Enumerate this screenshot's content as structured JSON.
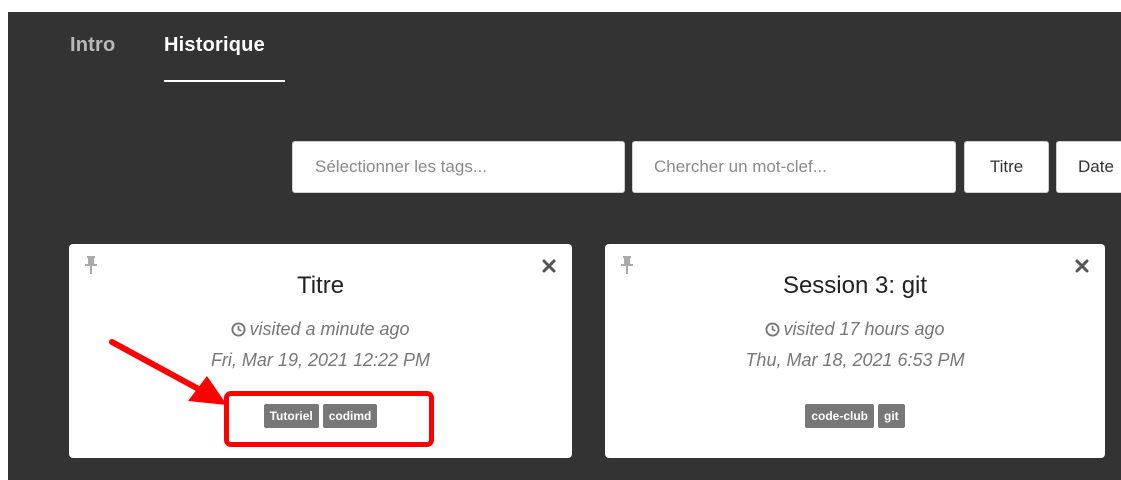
{
  "tabs": {
    "intro_label": "Intro",
    "historique_label": "Historique"
  },
  "toolbar": {
    "tags_placeholder": "Sélectionner les tags...",
    "search_placeholder": "Chercher un mot-clef...",
    "sort_title_label": "Titre",
    "sort_date_label": "Date"
  },
  "cards": [
    {
      "title": "Titre",
      "visited": "visited a minute ago",
      "date": "Fri, Mar 19, 2021 12:22 PM",
      "tags": [
        "Tutoriel",
        "codimd"
      ]
    },
    {
      "title": "Session 3: git",
      "visited": "visited 17 hours ago",
      "date": "Thu, Mar 18, 2021 6:53 PM",
      "tags": [
        "code-club",
        "git"
      ]
    }
  ],
  "colors": {
    "background": "#333333",
    "tag_background": "#777777",
    "annotation": "#ff0000"
  },
  "icons": {
    "pin": "thumbtack-icon",
    "close": "close-icon",
    "clock": "clock-icon"
  }
}
